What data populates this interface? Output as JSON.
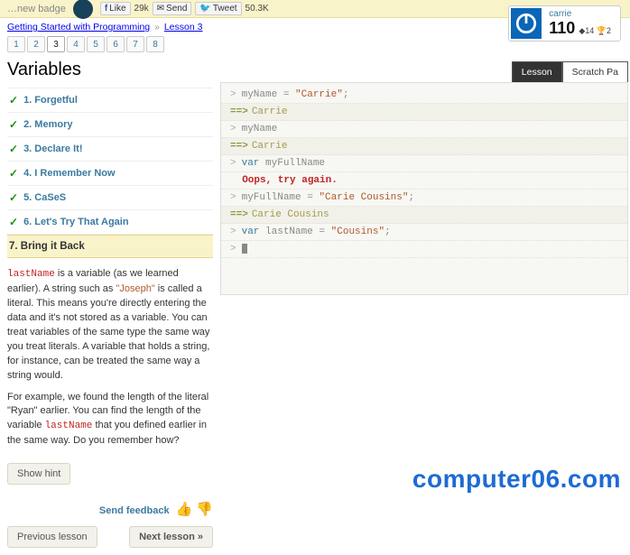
{
  "banner": {
    "badge_text": "…new badge",
    "like_label": "Like",
    "like_count": "29k",
    "send_label": "Send",
    "tweet_label": "Tweet",
    "tweet_count": "50.3K"
  },
  "breadcrumb": {
    "a": "Getting Started with Programming",
    "b": "Lesson 3"
  },
  "pager": [
    "1",
    "2",
    "3",
    "4",
    "5",
    "6",
    "7",
    "8"
  ],
  "pager_current": "3",
  "section_title": "Variables",
  "steps": [
    {
      "n": "1.",
      "label": "Forgetful",
      "done": true
    },
    {
      "n": "2.",
      "label": "Memory",
      "done": true
    },
    {
      "n": "3.",
      "label": "Declare It!",
      "done": true
    },
    {
      "n": "4.",
      "label": "I Remember Now",
      "done": true
    },
    {
      "n": "5.",
      "label": "CaSeS",
      "done": true
    },
    {
      "n": "6.",
      "label": "Let's Try That Again",
      "done": true
    },
    {
      "n": "7.",
      "label": "Bring it Back",
      "done": false,
      "current": true
    }
  ],
  "body": {
    "p1a": "lastName",
    "p1b": " is a variable (as we learned earlier). A string such as ",
    "p1c": "\"Joseph\"",
    "p1d": " is called a literal. This means you're directly entering the data and it's not stored as a variable. You can treat variables of the same type the same way you treat literals. A variable that holds a string, for instance, can be treated the same way a string would.",
    "p2a": "For example, we found the length of the literal \"Ryan\" earlier. You can find the length of the variable ",
    "p2b": "lastName",
    "p2c": " that you defined earlier in the same way. Do you remember how?"
  },
  "hint": "Show hint",
  "feedback": "Send feedback",
  "nav": {
    "prev": "Previous lesson",
    "next": "Next lesson »"
  },
  "user": {
    "name": "carrie",
    "points": "110",
    "badges1": "14",
    "badges2": "2"
  },
  "tabs": {
    "lesson": "Lesson",
    "scratch": "Scratch Pa"
  },
  "console": [
    {
      "t": "in",
      "kw": "",
      "v1": "myName ",
      "op": "= ",
      "str": "\"Carrie\"",
      "end": ";"
    },
    {
      "t": "out",
      "v": "Carrie"
    },
    {
      "t": "in",
      "v": "myName"
    },
    {
      "t": "out",
      "v": "Carrie"
    },
    {
      "t": "in",
      "kw": "var ",
      "v1": "myFullName"
    },
    {
      "t": "err",
      "v": "Oops, try again."
    },
    {
      "t": "in",
      "v1": "myFullName ",
      "op": "= ",
      "str": "\"Carie Cousins\"",
      "end": ";"
    },
    {
      "t": "out",
      "v": "Carie Cousins"
    },
    {
      "t": "in",
      "kw": "var ",
      "v1": "lastName ",
      "op": "= ",
      "str": "\"Cousins\"",
      "end": ";"
    },
    {
      "t": "cur"
    }
  ],
  "watermark": "computer06.com"
}
